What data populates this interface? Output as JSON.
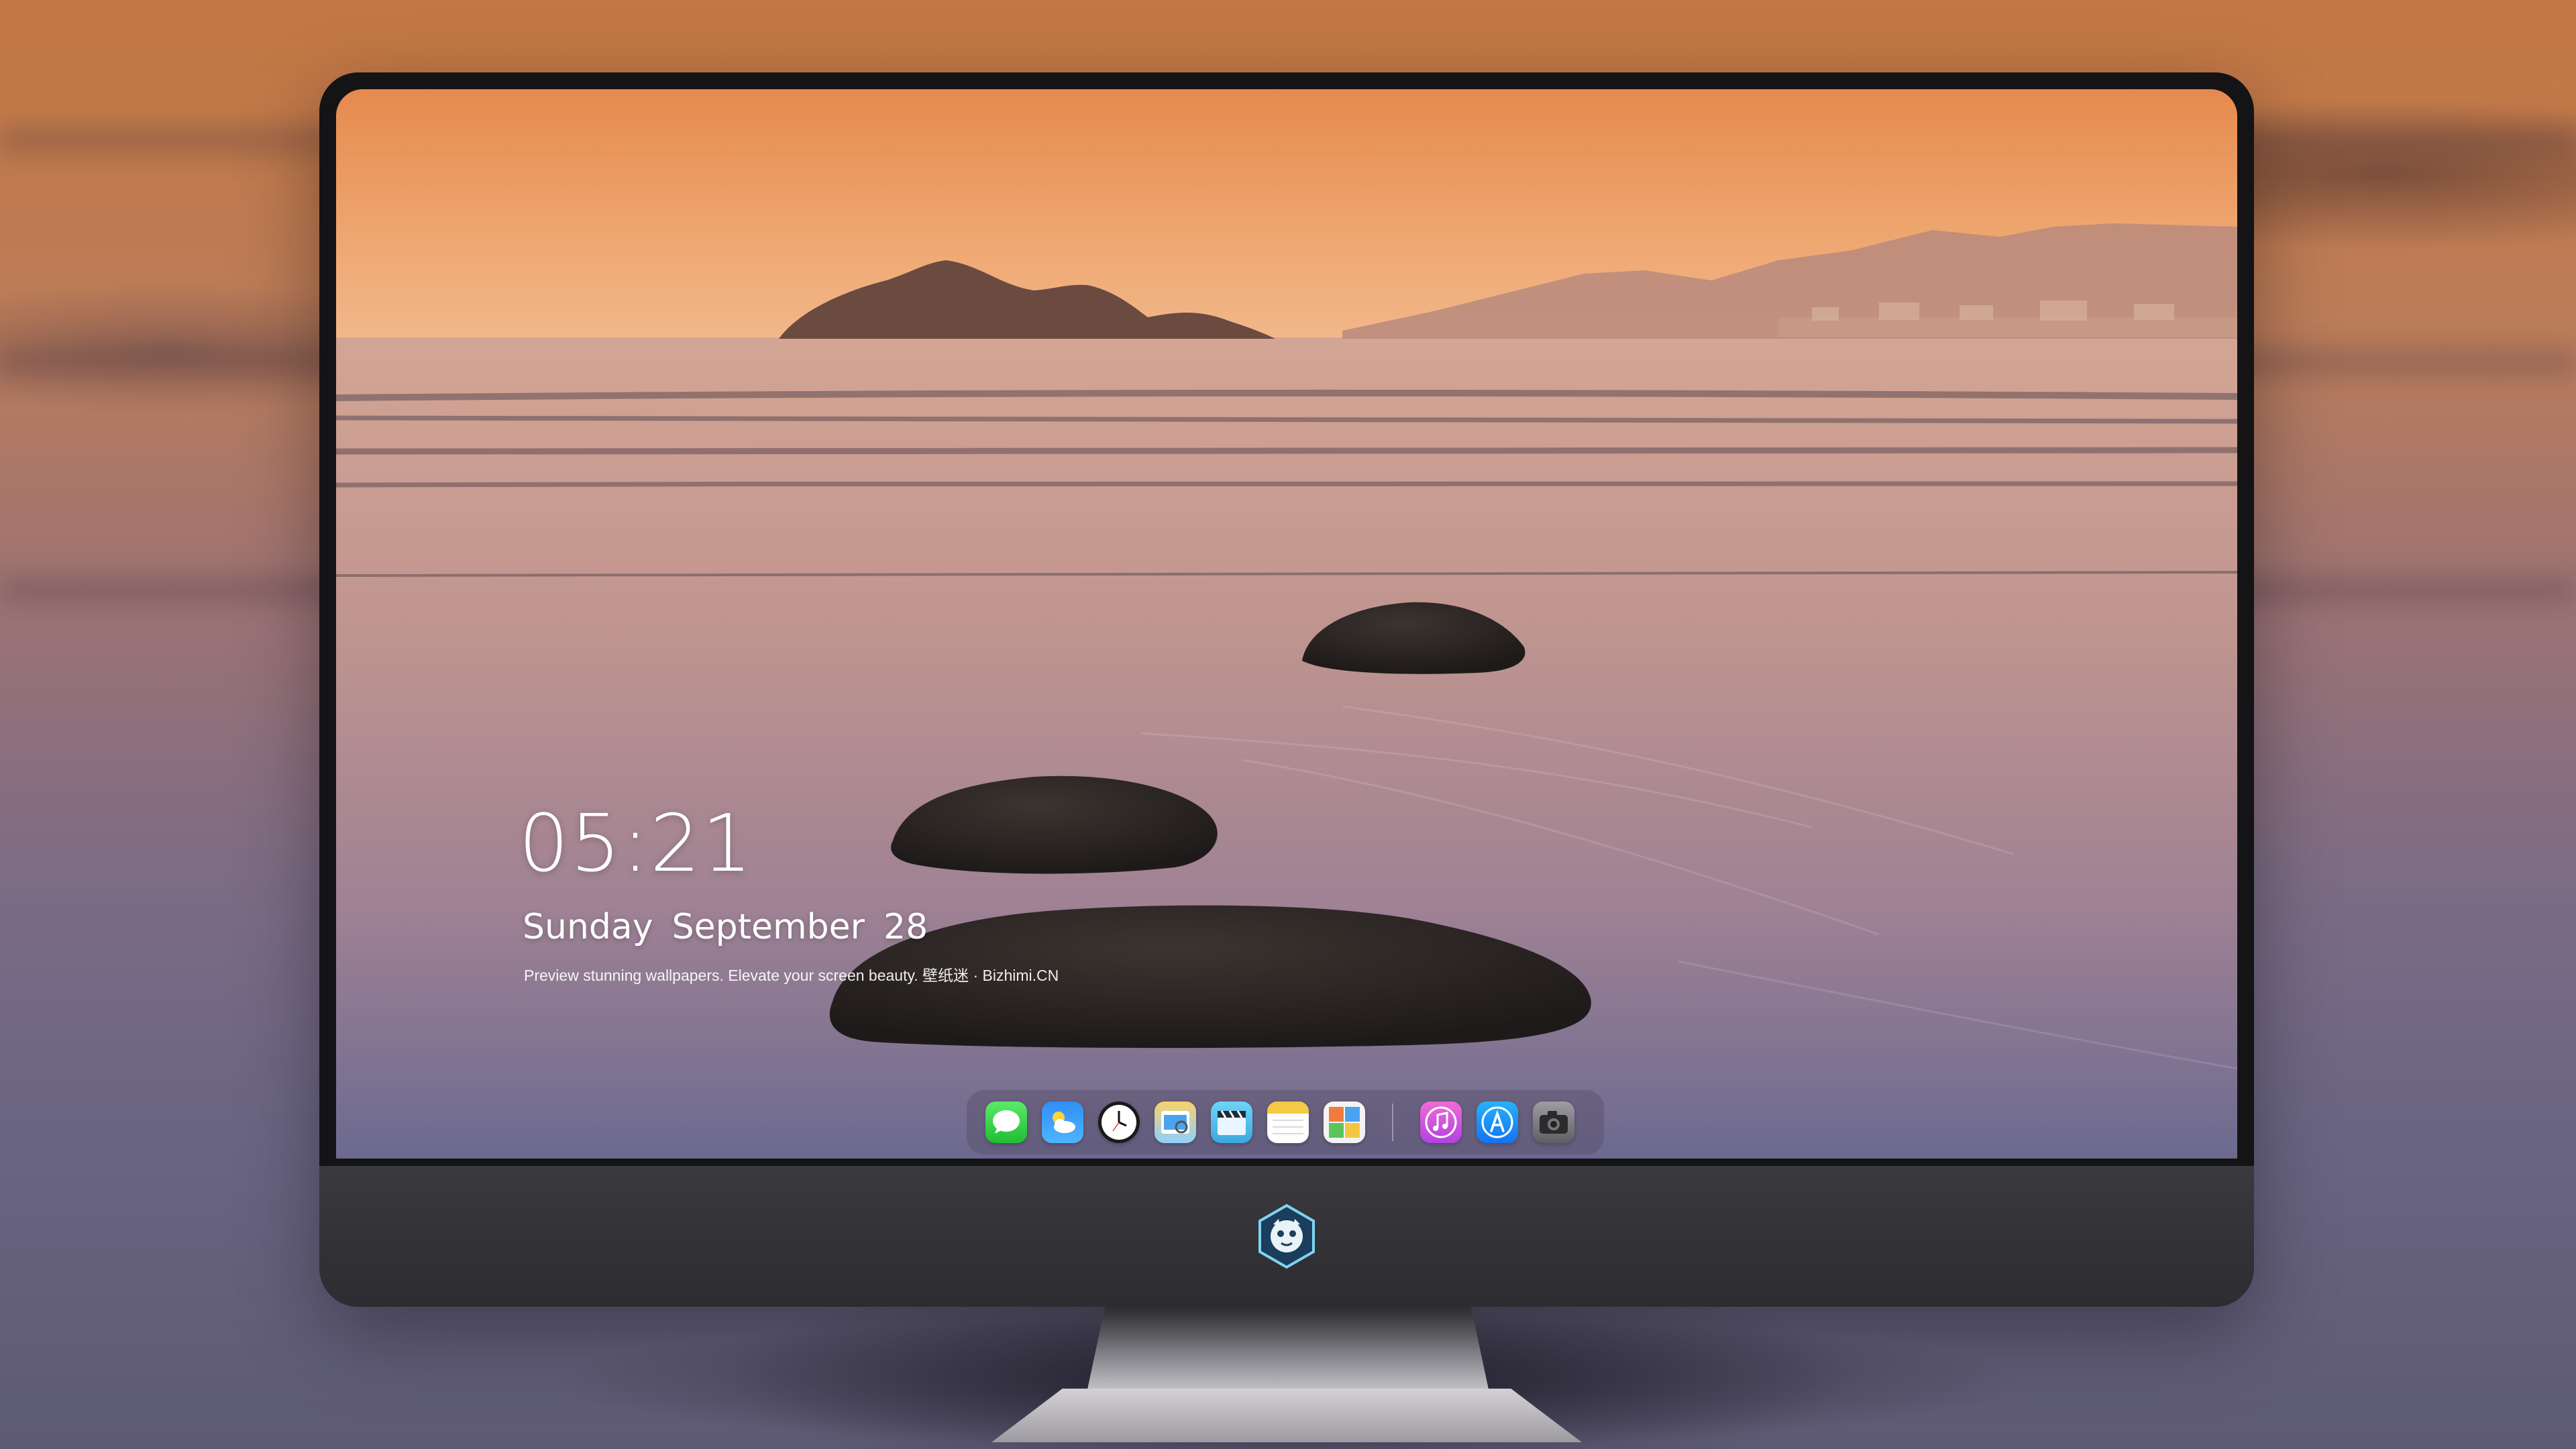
{
  "lock_screen": {
    "time": "05:21",
    "weekday": "Sunday",
    "month": "September",
    "day": "28",
    "tagline": "Preview stunning wallpapers. Elevate your screen beauty. 壁纸迷 · Bizhimi.CN"
  },
  "dock": {
    "apps": [
      {
        "name": "Messages",
        "icon": "messages-icon"
      },
      {
        "name": "Weather",
        "icon": "weather-icon"
      },
      {
        "name": "Clock",
        "icon": "clock-icon"
      },
      {
        "name": "Preview",
        "icon": "preview-icon"
      },
      {
        "name": "Clips",
        "icon": "clapperboard-icon"
      },
      {
        "name": "Notes",
        "icon": "notes-icon"
      },
      {
        "name": "Photo Booth",
        "icon": "photo-booth-icon"
      },
      {
        "name": "iTunes",
        "icon": "music-note-icon"
      },
      {
        "name": "App Store",
        "icon": "app-store-icon"
      },
      {
        "name": "Camera",
        "icon": "camera-icon"
      }
    ]
  },
  "monitor": {
    "logo": "mascot-logo-icon"
  },
  "colors": {
    "sky_top": "#e8975a",
    "sky_horizon": "#f0b07a",
    "water": "#b89098",
    "sand": "#6f6a8e",
    "rock": "#2b2623",
    "bezel": "#141416",
    "chin": "#333337"
  }
}
